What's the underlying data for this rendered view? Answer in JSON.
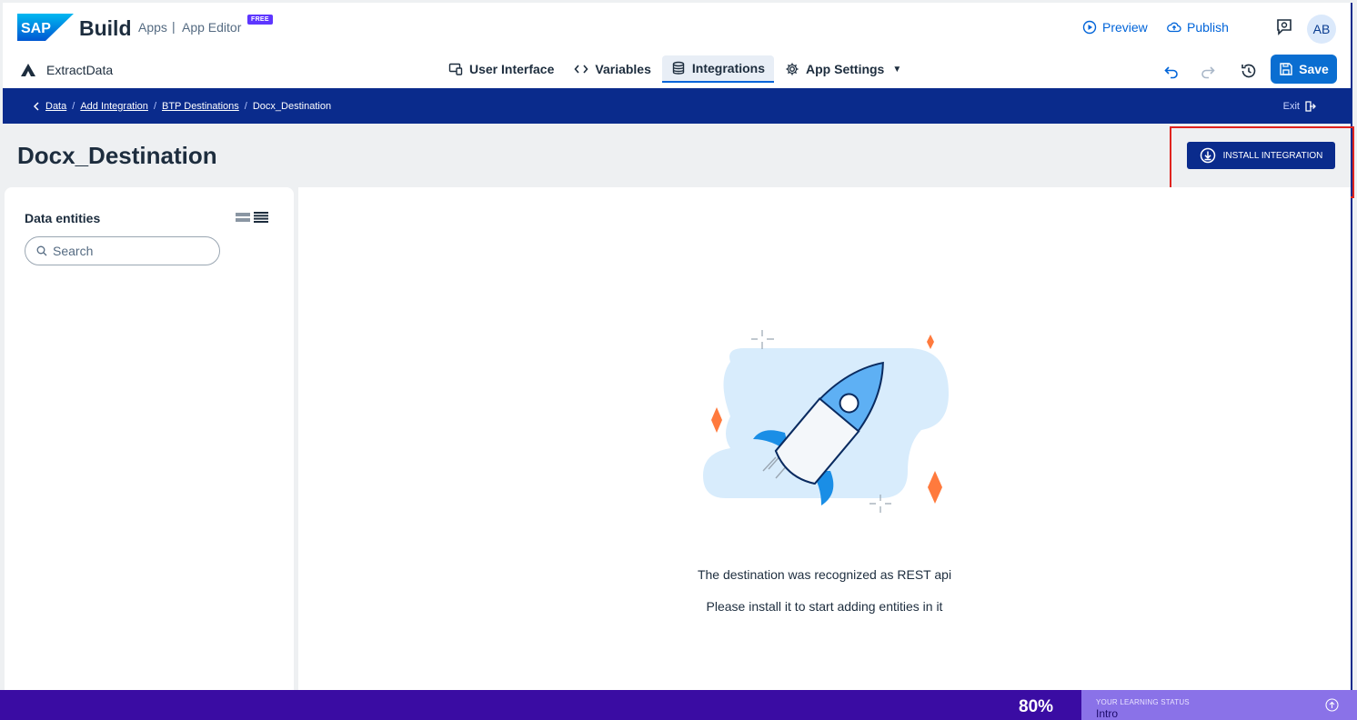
{
  "header": {
    "brand_build": "Build",
    "brand_apps": "Apps",
    "brand_sep": "|",
    "brand_editor": "App Editor",
    "free_badge": "FREE",
    "preview": "Preview",
    "publish": "Publish",
    "avatar": "AB"
  },
  "toolbar": {
    "app_name": "ExtractData",
    "tabs": [
      {
        "label": "User Interface",
        "icon": "ui-icon"
      },
      {
        "label": "Variables",
        "icon": "code-icon"
      },
      {
        "label": "Integrations",
        "icon": "database-icon",
        "active": true
      },
      {
        "label": "App Settings",
        "icon": "gear-icon"
      }
    ],
    "save": "Save"
  },
  "breadcrumb": {
    "items": [
      "Data",
      "Add Integration",
      "BTP Destinations",
      "Docx_Destination"
    ],
    "separator": "/",
    "exit": "Exit"
  },
  "page": {
    "title": "Docx_Destination",
    "install_button": "INSTALL INTEGRATION"
  },
  "left_panel": {
    "title": "Data entities",
    "search_placeholder": "Search"
  },
  "main": {
    "message_line1": "The destination was recognized as REST api",
    "message_line2": "Please install it to start adding entities in it"
  },
  "learning": {
    "percent": "80%",
    "label": "YOUR LEARNING STATUS",
    "value": "Intro"
  },
  "colors": {
    "primary": "#0a6ed1",
    "breadcrumb_bar": "#0a2b8c",
    "learning_bar": "#3a0ca3",
    "highlight": "#e0241f",
    "accent_orange": "#ff7a3d"
  }
}
